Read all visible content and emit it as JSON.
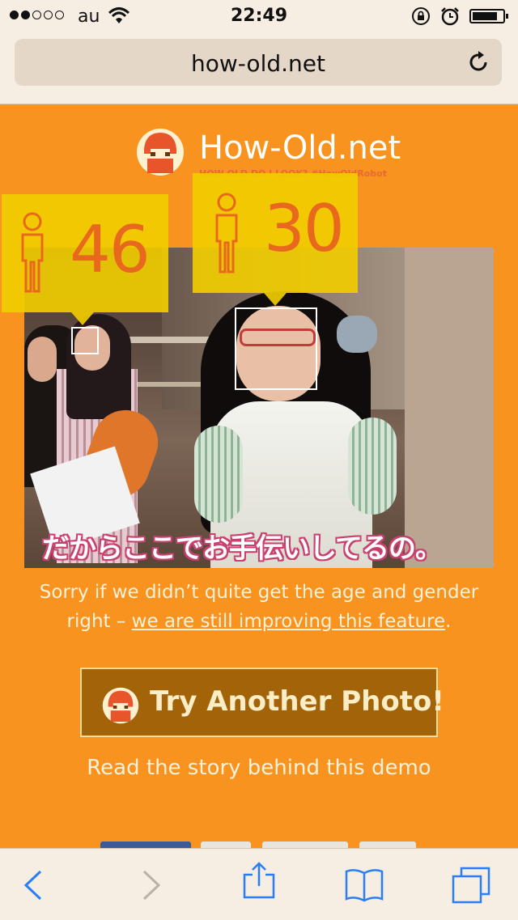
{
  "status_bar": {
    "carrier": "au",
    "time": "22:49",
    "signal_strength": 2,
    "signal_max": 5
  },
  "browser": {
    "url": "how-old.net"
  },
  "header": {
    "brand": "How-Old.net",
    "tagline": "HOW OLD DO I LOOK? #HowOldRobot"
  },
  "faces": [
    {
      "age": "46"
    },
    {
      "age": "30"
    }
  ],
  "photo": {
    "caption": "だからここでお手伝いしてるの。"
  },
  "notice": {
    "text": "Sorry if we didn’t quite get the age and gender right – ",
    "link": "we are still improving this feature",
    "suffix": "."
  },
  "cta": {
    "label": "Try Another Photo!"
  },
  "story_link": "Read the story behind this demo",
  "colors": {
    "page_bg": "#f7931e",
    "bubble": "#f0cc00",
    "age_text": "#e8681e",
    "button_bg": "#a26309",
    "ios_blue": "#2a7ef5"
  },
  "toolbar": {
    "icons": [
      "back-icon",
      "forward-icon",
      "share-icon",
      "bookmarks-icon",
      "tabs-icon"
    ]
  }
}
